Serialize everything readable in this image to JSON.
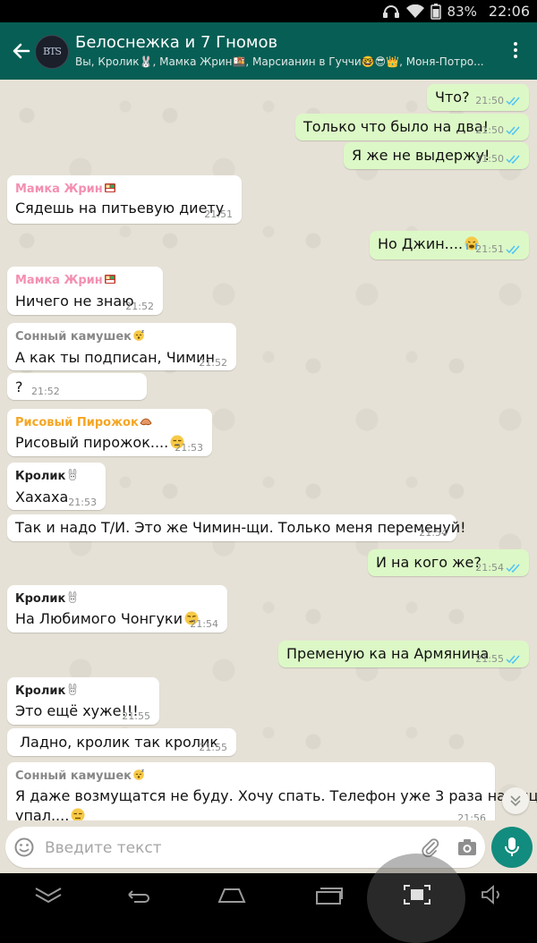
{
  "status_bar": {
    "battery": "83%",
    "time": "22:06"
  },
  "header": {
    "title": "Белоснежка и 7 Гномов",
    "subtitle": "Вы, Кролик🐰, Мамка Жрин🍱, Марсианин в Гуччи🤓😎👑, Моня-Потро... ,",
    "avatar_text": "BTS",
    "back_icon": "arrow-left-icon",
    "menu_icon": "more-vert-icon"
  },
  "colors": {
    "header": "#075e54",
    "outgoing_bubble": "#dcf8c6",
    "incoming_bubble": "#ffffff",
    "chat_background": "#e6e1d6",
    "read_tick": "#4fc3f7",
    "mic_button": "#128c7e",
    "sender_mamka": "#f48fb1",
    "sender_sonny": "#888888",
    "sender_pirozhok": "#f5a623",
    "sender_krolik": "#222222"
  },
  "messages": [
    {
      "dir": "out",
      "text": "Что?",
      "time": "21:50"
    },
    {
      "dir": "out",
      "text": "Только что было на два!",
      "time": "21:50"
    },
    {
      "dir": "out",
      "text": "Я же не выдержу!",
      "time": "21:50"
    },
    {
      "dir": "in",
      "sender": "Мамка Жрин",
      "sender_emoji": "bento-emoji",
      "text": "Сядешь на питьевую диету",
      "time": "21:51"
    },
    {
      "dir": "out",
      "text": "Но Джин....",
      "emoji": "crying-emoji",
      "time": "21:51"
    },
    {
      "dir": "in",
      "sender": "Мамка Жрин",
      "sender_emoji": "bento-emoji",
      "text": "Ничего не знаю",
      "time": "21:52"
    },
    {
      "dir": "in",
      "sender": "Сонный камушек",
      "sender_emoji": "sleepy-emoji",
      "text": "А как ты подписан, Чимин",
      "time": "21:52"
    },
    {
      "dir": "in",
      "text": "?",
      "time": "21:52"
    },
    {
      "dir": "in",
      "sender": "Рисовый Пирожок",
      "sender_emoji": "croissant-emoji",
      "text": "Рисовый пирожок....",
      "emoji": "unamused-emoji",
      "time": "21:53"
    },
    {
      "dir": "in",
      "sender": "Кролик",
      "sender_emoji": "rabbit-emoji",
      "text": "Хахаха",
      "time": "21:53"
    },
    {
      "dir": "in",
      "text": "Так и надо Т/И. Это же Чимин-щи. Только меня переменуй!",
      "time": "21:54"
    },
    {
      "dir": "out",
      "text": "И на кого же?",
      "time": "21:54"
    },
    {
      "dir": "in",
      "sender": "Кролик",
      "sender_emoji": "rabbit-emoji",
      "text": "На Любимого Чонгуки",
      "emoji": "smirk-emoji",
      "time": "21:54"
    },
    {
      "dir": "out",
      "text": "Пременую ка на Армянина",
      "time": "21:55"
    },
    {
      "dir": "in",
      "sender": "Кролик",
      "sender_emoji": "rabbit-emoji",
      "text": "Это ещё хуже!!!",
      "time": "21:55"
    },
    {
      "dir": "in",
      "text": "Ладно, кролик так кролик",
      "time": "21:55"
    },
    {
      "dir": "in",
      "sender": "Сонный камушек",
      "sender_emoji": "sleepy-emoji",
      "text": "Я даже возмущатся не буду. Хочу спать. Телефон уже 3 раза на лицо",
      "text2": "упал....",
      "emoji": "unamused-emoji",
      "time": "21:56"
    }
  ],
  "input": {
    "placeholder": "Введите текст"
  }
}
